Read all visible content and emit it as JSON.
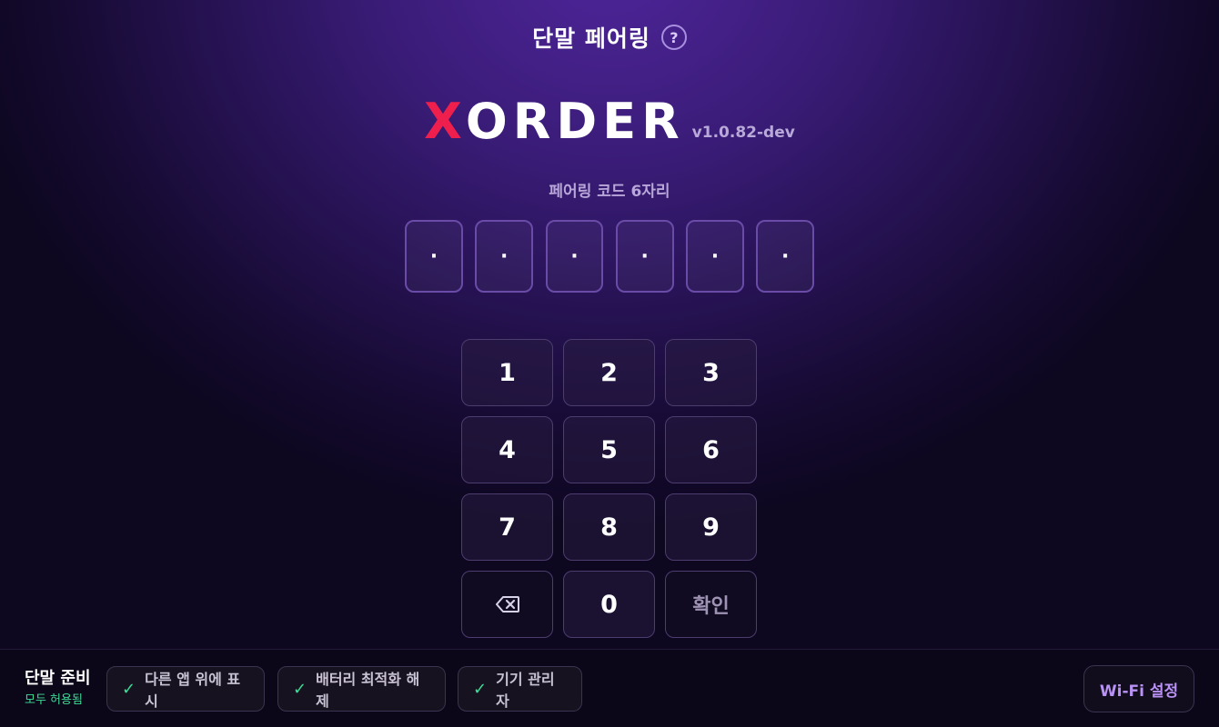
{
  "header": {
    "title": "단말 페어링",
    "help_label": "?"
  },
  "brand": {
    "logo_first": "X",
    "logo_rest": "ORDER",
    "version": "v1.0.82-dev",
    "accent_color": "#ee1f4d"
  },
  "pairing": {
    "label": "페어링 코드 6자리",
    "cells": [
      "·",
      "·",
      "·",
      "·",
      "·",
      "·"
    ]
  },
  "keypad": {
    "keys": [
      "1",
      "2",
      "3",
      "4",
      "5",
      "6",
      "7",
      "8",
      "9"
    ],
    "backspace_icon": "backspace-icon",
    "zero": "0",
    "confirm": "확인"
  },
  "footer": {
    "ready_title": "단말 준비",
    "ready_status": "모두 허용됨",
    "status_color": "#3ddc97",
    "permissions": [
      {
        "check": "✓",
        "label": "다른 앱 위에 표시"
      },
      {
        "check": "✓",
        "label": "배터리 최적화 해제"
      },
      {
        "check": "✓",
        "label": "기기 관리자"
      }
    ],
    "wifi_label": "Wi-Fi 설정"
  }
}
